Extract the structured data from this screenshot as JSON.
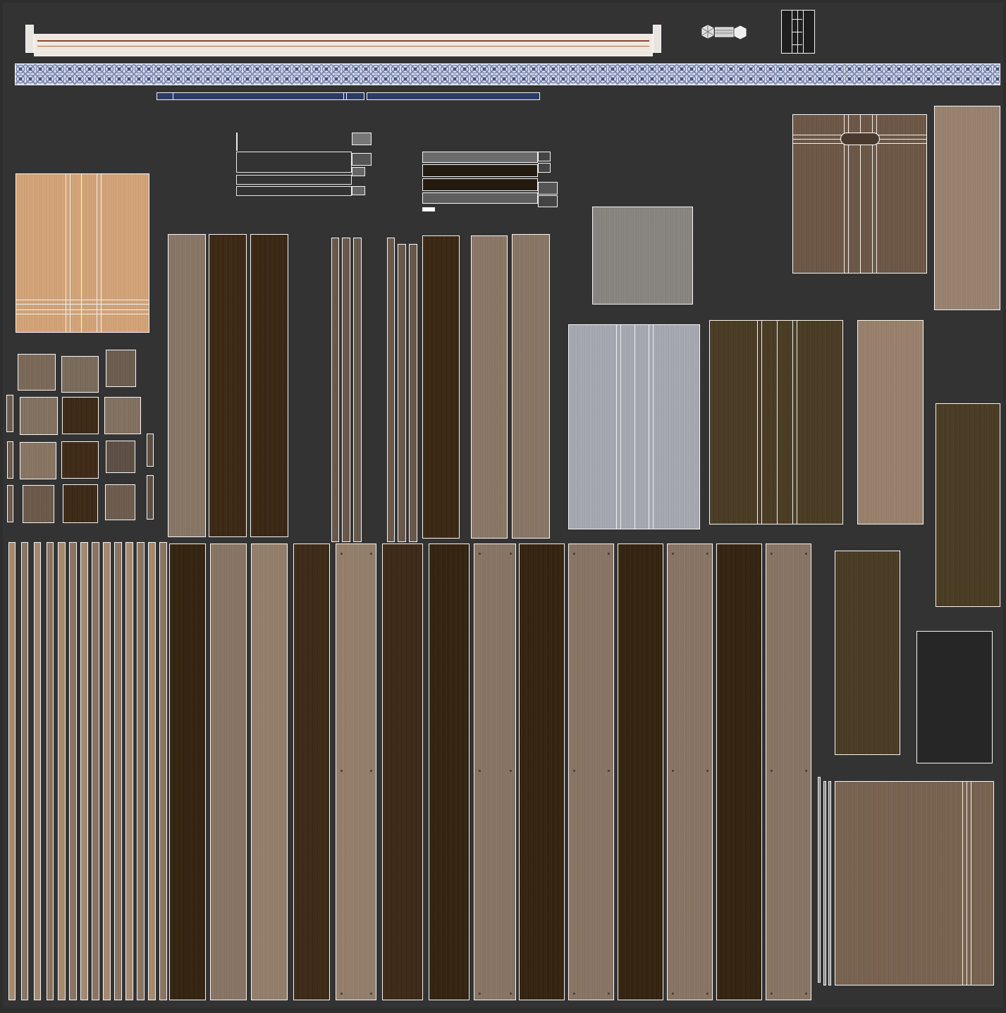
{
  "sheet": {
    "description_visible_text": "",
    "background_color": "#333333"
  },
  "colors": {
    "wood_light": "#8a7665",
    "wood_light_alt": "#95806c",
    "wood_dark": "#3e2a17",
    "wood_dark_alt": "#34230f",
    "tan": "#d7a679",
    "olive": "#4a3c23",
    "blue_grey": "#a8abb4",
    "grey": "#8a8782",
    "brown_panel": "#6e5847",
    "brown_panel_alt": "#9b8470",
    "charcoal": "#262626",
    "lace_blue": "#6e7bab",
    "navy": "#2c3a6a",
    "wireframe": "#f4f4f4"
  },
  "icons": [
    "hexagon-nut-icon",
    "bolt-icon"
  ]
}
